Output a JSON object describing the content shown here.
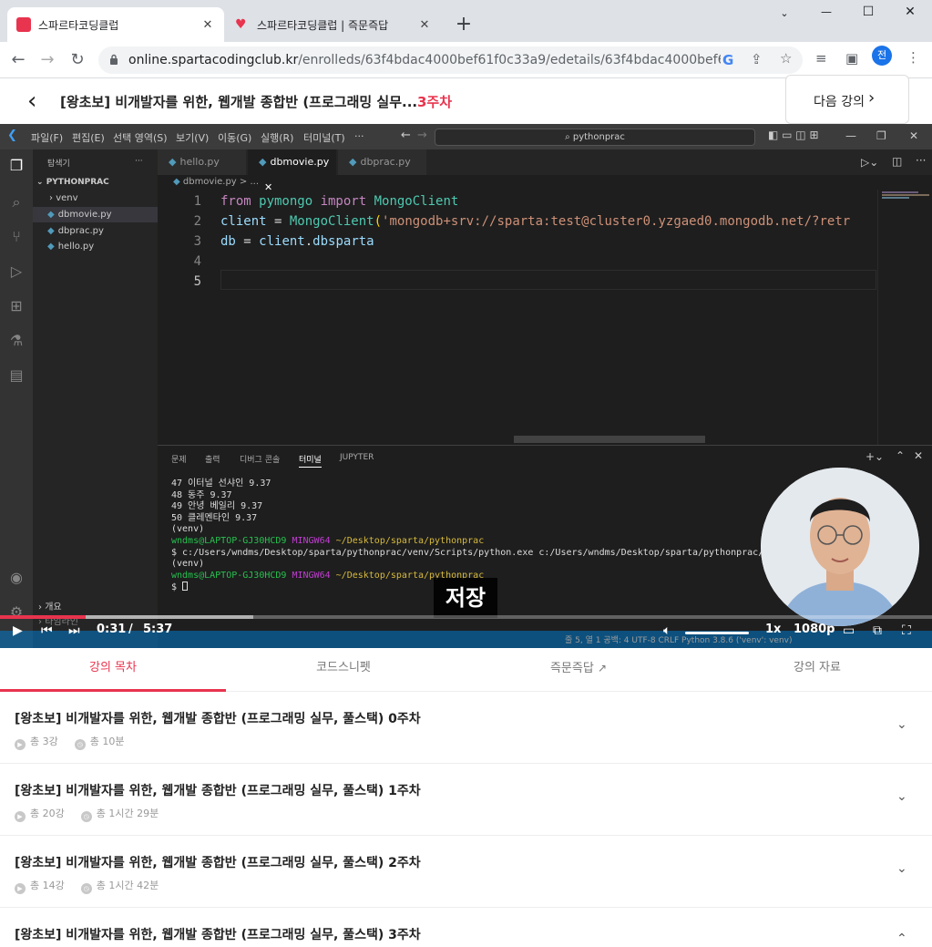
{
  "browser": {
    "tabs": [
      {
        "title": "스파르타코딩클럽",
        "active": true,
        "favicon_color": "#e8344e"
      },
      {
        "title": "스파르타코딩클럽 | 즉문즉답",
        "active": false,
        "favicon_color": "#e8344e"
      }
    ],
    "new_tab": "+",
    "window_controls": {
      "minimize": "—",
      "maximize": "☐",
      "close": "✕"
    },
    "tab_close": "✕",
    "url": {
      "host": "online.spartacodingclub.kr",
      "path": "/enrolleds/63f4bdac4000bef61f0c33a9/edetails/63f4bdac4000bef61f0c33..."
    },
    "profile_initial": "전"
  },
  "course_header": {
    "title": "[왕초보] 비개발자를 위한, 웹개발 종합반 (프로그래밍 실무...",
    "week": "3주차",
    "next_label": "다음 강의"
  },
  "vscode": {
    "menus": [
      "파일(F)",
      "편집(E)",
      "선택 영역(S)",
      "보기(V)",
      "이동(G)",
      "실행(R)",
      "터미널(T)",
      "···"
    ],
    "search": "pythonprac",
    "explorer_title": "탐색기",
    "explorer_more": "···",
    "project": "PYTHONPRAC",
    "files": [
      "venv",
      "dbmovie.py",
      "dbprac.py",
      "hello.py"
    ],
    "selected_file": "dbmovie.py",
    "tabs": [
      "hello.py",
      "dbmovie.py",
      "dbprac.py"
    ],
    "active_tab": "dbmovie.py",
    "breadcrumb": "dbmovie.py > ...",
    "code": {
      "line_numbers": [
        "1",
        "2",
        "3",
        "4",
        "5"
      ],
      "line1": [
        "from",
        " pymongo ",
        "import",
        " MongoClient"
      ],
      "line2": [
        "client",
        " = ",
        "MongoClient",
        "(",
        "'mongodb+srv://sparta:test@cluster0.yzgaed0.mongodb.net/?retr"
      ],
      "line3": [
        "db",
        " = ",
        "client",
        ".",
        "dbsparta"
      ]
    },
    "panel_tabs": [
      "문제",
      "출력",
      "디버그 콘솔",
      "터미널",
      "JUPYTER"
    ],
    "active_panel_tab": "터미널",
    "terminal": {
      "lines": [
        "47 이터널 선샤인 9.37",
        "48 동주 9.37",
        "49 안녕 베일리 9.37",
        "50 클레멘타인 9.37",
        "(venv)"
      ],
      "prompt_user": "wndms@LAPTOP-GJ30HCD9",
      "prompt_shell": "MINGW64",
      "prompt_path": "~/Desktop/sparta/pythonprac",
      "command": "$ c:/Users/wndms/Desktop/sparta/pythonprac/venv/Scripts/python.exe c:/Users/wndms/Desktop/sparta/pythonprac/hel",
      "after": "(venv)",
      "prompt_path2": "~/Desktop/sparta/pythonprac",
      "cursor_line": "$ "
    },
    "outline_label": "개요",
    "timeline_label": "타임라인",
    "status_bar": "줄 5, 열 1   공백: 4   UTF-8   CRLF   Python   3.8.6 ('venv': venv)"
  },
  "video": {
    "subtitle": "저장",
    "current_time": "0:31",
    "separator": "/",
    "duration": "5:37",
    "progress_fraction": 0.092,
    "speed": "1x",
    "quality": "1080p",
    "played_color": "#e8344e"
  },
  "lesson_tabs": [
    {
      "label": "강의 목차",
      "active": true
    },
    {
      "label": "코드스니펫",
      "active": false
    },
    {
      "label": "즉문즉답",
      "active": false,
      "external": true
    },
    {
      "label": "강의 자료",
      "active": false
    }
  ],
  "weeks": [
    {
      "title": "[왕초보] 비개발자를 위한, 웹개발 종합반 (프로그래밍 실무, 풀스택) 0주차",
      "lectures": "총 3강",
      "time": "총 10분",
      "expanded": false
    },
    {
      "title": "[왕초보] 비개발자를 위한, 웹개발 종합반 (프로그래밍 실무, 풀스택) 1주차",
      "lectures": "총 20강",
      "time": "총 1시간 29분",
      "expanded": false
    },
    {
      "title": "[왕초보] 비개발자를 위한, 웹개발 종합반 (프로그래밍 실무, 풀스택) 2주차",
      "lectures": "총 14강",
      "time": "총 1시간 42분",
      "expanded": false
    },
    {
      "title": "[왕초보] 비개발자를 위한, 웹개발 종합반 (프로그래밍 실무, 풀스택) 3주차",
      "lectures": "",
      "time": "",
      "expanded": true
    }
  ],
  "colors": {
    "brand": "#e8344e",
    "vscode_bg": "#1e1e1e",
    "chrome_tabs_bg": "#dee1e6"
  }
}
